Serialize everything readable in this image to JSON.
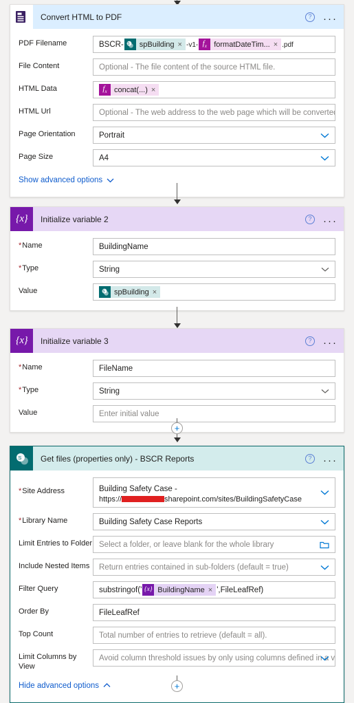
{
  "meta": {
    "accent_blue": "#0078d4",
    "sharepoint_teal": "#036c70",
    "variable_purple": "#7719aa",
    "expression_magenta": "#a4139b",
    "required_red": "#a4262c",
    "redaction_red": "#e02020"
  },
  "icons": {
    "help": "?",
    "ellipsis": "···",
    "plus": "+",
    "token_remove": "×",
    "variable_glyph": "{x}",
    "expression_glyph": "fx"
  },
  "cards": [
    {
      "id": "convert-html-to-pdf",
      "title": "Convert HTML to PDF",
      "icon": "pdf-printer-icon",
      "rows": [
        {
          "label": "PDF Filename",
          "required": false,
          "kind": "composite",
          "parts": [
            {
              "type": "text",
              "text": "BSCR-"
            },
            {
              "type": "token",
              "style": "sharepoint",
              "label": "spBuilding"
            },
            {
              "type": "subtext",
              "text": "-v1-"
            },
            {
              "type": "token",
              "style": "expression",
              "label": "formatDateTim..."
            },
            {
              "type": "subtext",
              "text": ".pdf"
            }
          ]
        },
        {
          "label": "File Content",
          "required": false,
          "kind": "placeholder",
          "placeholder": "Optional - The file content of the source HTML file."
        },
        {
          "label": "HTML Data",
          "required": false,
          "kind": "composite",
          "parts": [
            {
              "type": "token",
              "style": "expression",
              "label": "concat(...)"
            }
          ]
        },
        {
          "label": "HTML Url",
          "required": false,
          "kind": "placeholder",
          "placeholder": "Optional - The web address to the web page which will be converted to a PDF c"
        },
        {
          "label": "Page Orientation",
          "required": false,
          "kind": "dropdown",
          "value": "Portrait"
        },
        {
          "label": "Page Size",
          "required": false,
          "kind": "dropdown",
          "value": "A4"
        }
      ],
      "advanced_link": "Show advanced options",
      "advanced_state": "collapsed"
    },
    {
      "id": "initialize-variable-2",
      "title": "Initialize variable 2",
      "icon": "variable-icon",
      "rows": [
        {
          "label": "Name",
          "required": true,
          "kind": "value",
          "value": "BuildingName"
        },
        {
          "label": "Type",
          "required": true,
          "kind": "dropdown",
          "value": "String"
        },
        {
          "label": "Value",
          "required": false,
          "kind": "composite",
          "parts": [
            {
              "type": "token",
              "style": "sharepoint",
              "label": "spBuilding"
            }
          ]
        }
      ]
    },
    {
      "id": "initialize-variable-3",
      "title": "Initialize variable 3",
      "icon": "variable-icon",
      "rows": [
        {
          "label": "Name",
          "required": true,
          "kind": "value",
          "value": "FileName"
        },
        {
          "label": "Type",
          "required": true,
          "kind": "dropdown",
          "value": "String"
        },
        {
          "label": "Value",
          "required": false,
          "kind": "placeholder",
          "placeholder": "Enter initial value"
        }
      ]
    },
    {
      "id": "get-files-properties-only-bscr-reports",
      "title": "Get files (properties only) - BSCR Reports",
      "icon": "sharepoint-icon",
      "selected": true,
      "rows": [
        {
          "label": "Site Address",
          "required": true,
          "kind": "site",
          "site_name": "Building Safety Case -",
          "url_prefix": "https://",
          "url_redacted": true,
          "url_suffix": "sharepoint.com/sites/BuildingSafetyCase"
        },
        {
          "label": "Library Name",
          "required": true,
          "kind": "dropdown",
          "value": "Building Safety Case Reports"
        },
        {
          "label": "Limit Entries to Folder",
          "required": false,
          "kind": "folderpicker",
          "placeholder": "Select a folder, or leave blank for the whole library"
        },
        {
          "label": "Include Nested Items",
          "required": false,
          "kind": "dropdown-placeholder",
          "placeholder": "Return entries contained in sub-folders (default = true)"
        },
        {
          "label": "Filter Query",
          "required": false,
          "kind": "composite",
          "parts": [
            {
              "type": "text",
              "text": "substringof('"
            },
            {
              "type": "token",
              "style": "variable",
              "label": "BuildingName"
            },
            {
              "type": "text",
              "text": "',FileLeafRef)"
            }
          ]
        },
        {
          "label": "Order By",
          "required": false,
          "kind": "value",
          "value": "FileLeafRef"
        },
        {
          "label": "Top Count",
          "required": false,
          "kind": "placeholder",
          "placeholder": "Total number of entries to retrieve (default = all)."
        },
        {
          "label": "Limit Columns by View",
          "required": false,
          "kind": "dropdown-placeholder",
          "placeholder": "Avoid column threshold issues by only using columns defined in a view"
        }
      ],
      "advanced_link": "Hide advanced options",
      "advanced_state": "expanded"
    }
  ]
}
